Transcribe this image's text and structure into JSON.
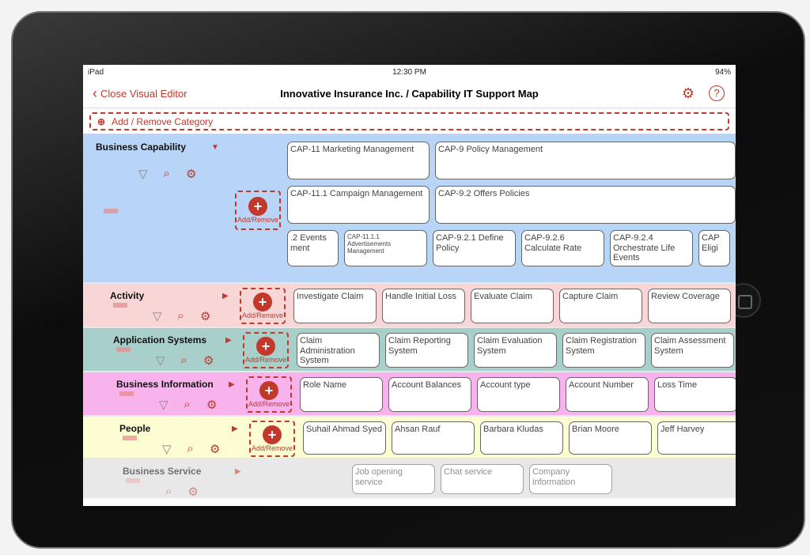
{
  "status": {
    "device": "iPad",
    "time": "12:30 PM",
    "battery": "94%"
  },
  "nav": {
    "back_label": "Close Visual Editor",
    "title": "Innovative Insurance Inc. / Capability IT Support Map",
    "settings_icon": "gear-icon",
    "help_icon": "help-icon"
  },
  "add_category": "Add / Remove Category",
  "add_remove_label": "Add/Remove",
  "capability": {
    "label": "Business Capability",
    "row1": [
      "CAP-11 Marketing Management",
      "CAP-9 Policy Management"
    ],
    "row2": [
      "CAP-11.1 Campaign Management",
      "CAP-9.2 Offers Policies"
    ],
    "row3": [
      ".2 Events ment",
      "CAP-11.1.1 Advertisements Management",
      "CAP-9.2.1 Define Policy",
      "CAP-9.2.6 Calculate Rate",
      "CAP-9.2.4 Orchestrate Life Events",
      "CAP Eligi"
    ]
  },
  "lanes": [
    {
      "label": "Activity",
      "color": "#f9d6d6",
      "items": [
        "Investigate Claim",
        "Handle Initial Loss",
        "Evaluate Claim",
        "Capture Claim",
        "Review Coverage"
      ]
    },
    {
      "label": "Application Systems",
      "color": "#a9cfcb",
      "items": [
        "Claim Administration System",
        "Claim Reporting System",
        "Claim Evaluation System",
        "Claim Registration System",
        "Claim Assessment System"
      ]
    },
    {
      "label": "Business Information",
      "color": "#f9b3ec",
      "items": [
        "Role Name",
        "Account Balances",
        "Account type",
        "Account Number",
        "Loss Time"
      ]
    },
    {
      "label": "People",
      "color": "#fdfdd4",
      "items": [
        "Suhail Ahmad Syed",
        "Ahsan Rauf",
        "Barbara Kludas",
        "Brian Moore",
        "Jeff Harvey"
      ]
    },
    {
      "label": "Business Service",
      "color": "#d9d9d9",
      "items": [
        "Job opening service",
        "Chat service",
        "Company information"
      ]
    }
  ],
  "colors": {
    "accent": "#c0392b",
    "capability_bg": "#b8d4f7"
  }
}
